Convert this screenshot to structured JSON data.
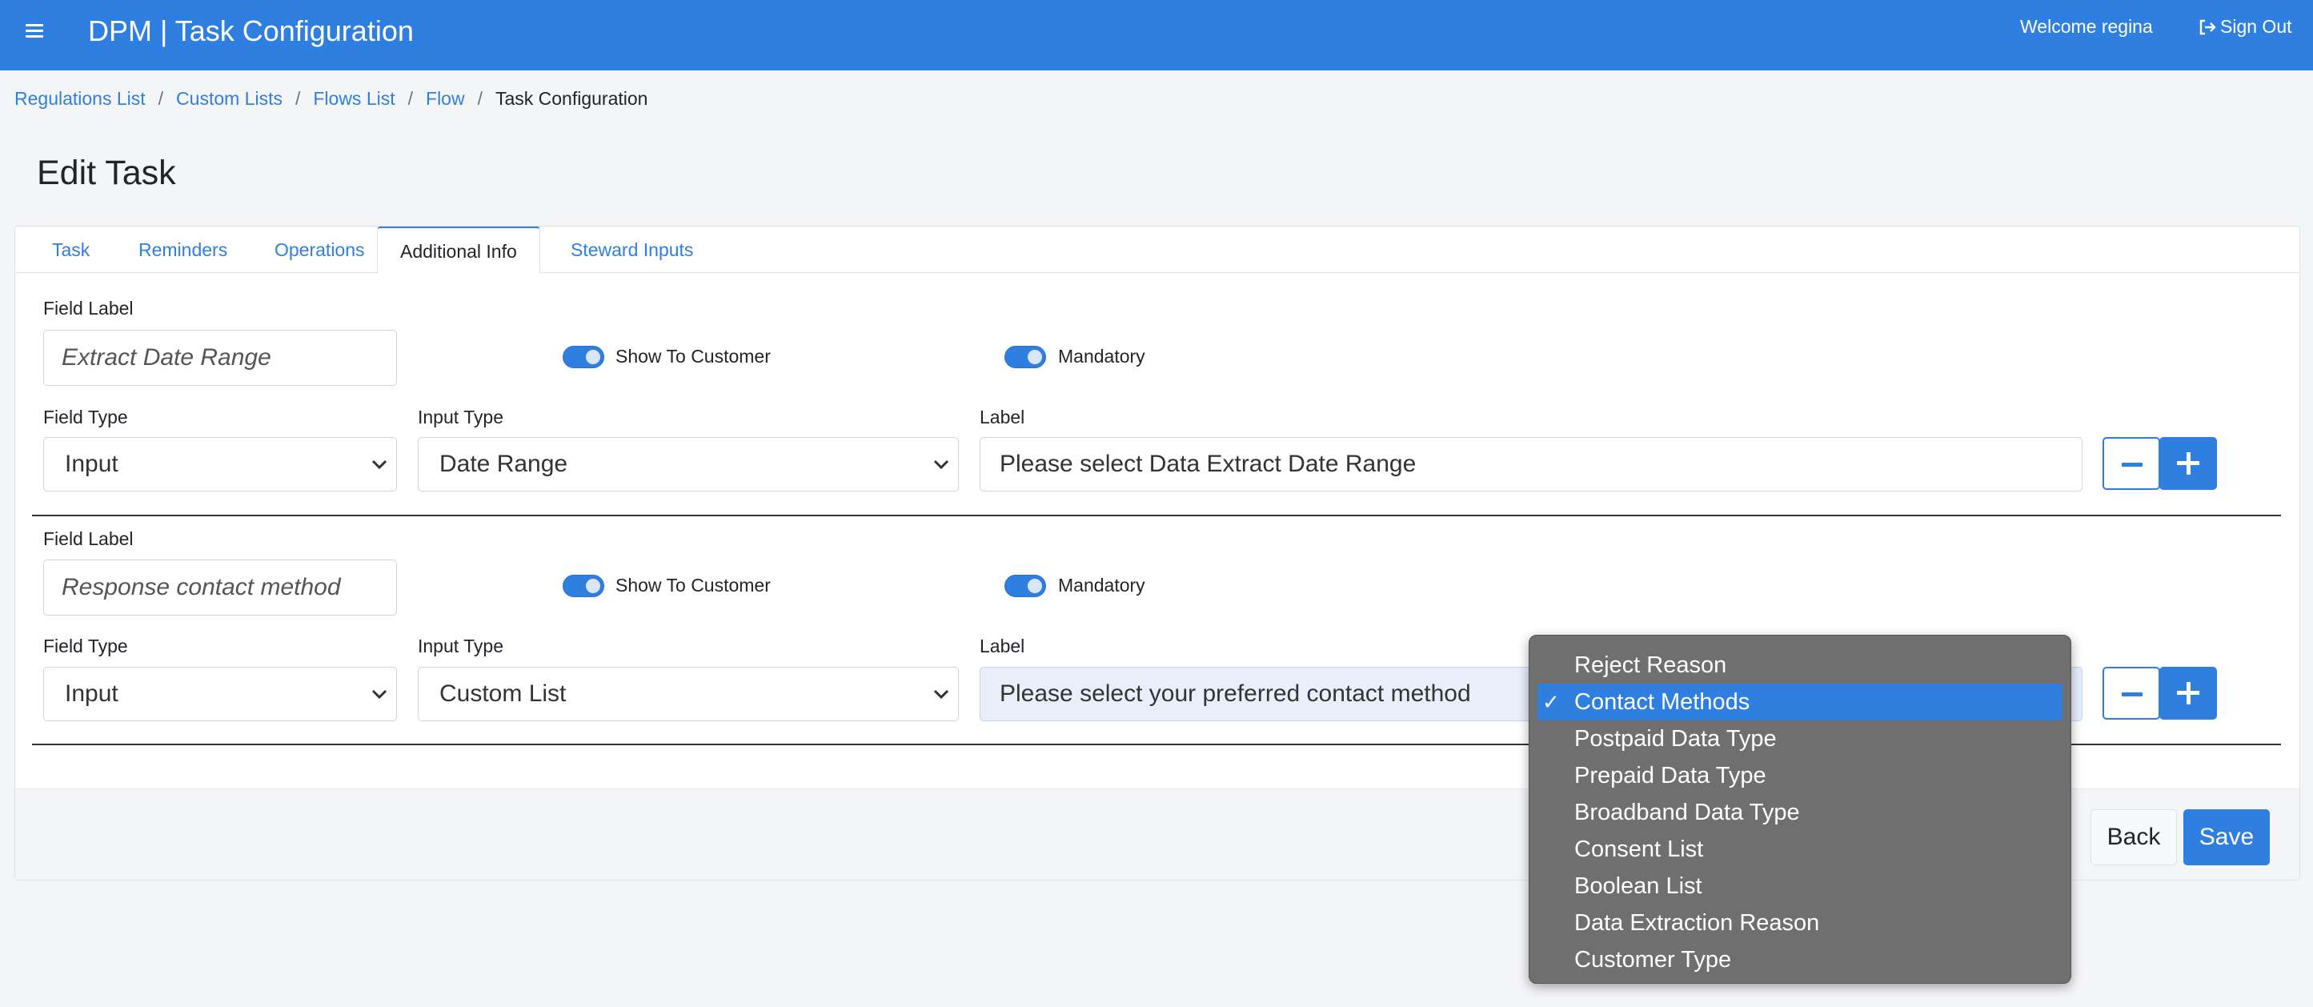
{
  "header": {
    "title": "DPM | Task Configuration",
    "welcome": "Welcome regina",
    "signout": "Sign Out"
  },
  "breadcrumb": {
    "items": [
      "Regulations List",
      "Custom Lists",
      "Flows List",
      "Flow"
    ],
    "separator": "/",
    "current": "Task Configuration"
  },
  "page": {
    "title": "Edit Task"
  },
  "tabs": [
    "Task",
    "Reminders",
    "Operations",
    "Additional Info",
    "Steward Inputs"
  ],
  "active_tab": "Additional Info",
  "fields": [
    {
      "field_label_caption": "Field Label",
      "field_label_value": "Extract Date Range",
      "show_to_customer": "Show To Customer",
      "mandatory": "Mandatory",
      "field_type_caption": "Field Type",
      "field_type": "Input",
      "input_type_caption": "Input Type",
      "input_type": "Date Range",
      "label_caption": "Label",
      "label_value": "Please select Data Extract Date Range"
    },
    {
      "field_label_caption": "Field Label",
      "field_label_value": "Response contact method",
      "show_to_customer": "Show To Customer",
      "mandatory": "Mandatory",
      "field_type_caption": "Field Type",
      "field_type": "Input",
      "input_type_caption": "Input Type",
      "input_type": "Custom List",
      "label_caption": "Label",
      "label_value": "Please select your preferred contact method"
    }
  ],
  "dropdown": {
    "options": [
      "Reject Reason",
      "Contact Methods",
      "Postpaid Data Type",
      "Prepaid Data Type",
      "Broadband Data Type",
      "Consent List",
      "Boolean List",
      "Data Extraction Reason",
      "Customer Type"
    ],
    "selected": "Contact Methods",
    "check_mark": "✓"
  },
  "footer": {
    "back": "Back",
    "save": "Save"
  },
  "colors": {
    "primary": "#2f7fe0",
    "dropdown_bg": "#6f6f6f"
  },
  "icons": [
    "hamburger-icon",
    "sign-out-icon",
    "chevron-down-icon",
    "minus-icon",
    "plus-icon",
    "check-icon"
  ]
}
